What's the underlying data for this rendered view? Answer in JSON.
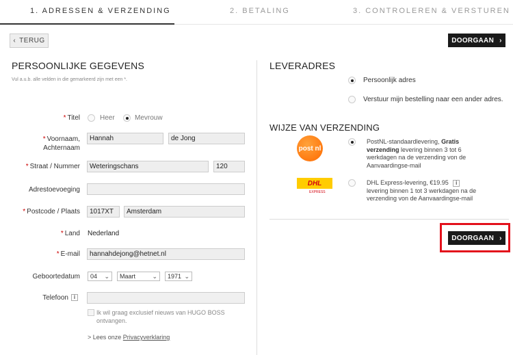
{
  "steps": [
    {
      "label": "1. ADRESSEN & VERZENDING"
    },
    {
      "label": "2. BETALING"
    },
    {
      "label": "3. CONTROLEREN & VERSTUREN"
    }
  ],
  "toolbar": {
    "back_label": "TERUG",
    "continue_label": "DOORGAAN"
  },
  "personal": {
    "heading": "PERSOONLIJKE GEGEVENS",
    "note": "Vul a.u.b. alle velden in die gemarkeerd zijn met een *.",
    "title_label": "Titel",
    "title_options": [
      "Heer",
      "Mevrouw"
    ],
    "name_label_1": "Voornaam,",
    "name_label_2": "Achternaam",
    "first_name": "Hannah",
    "last_name": "de Jong",
    "street_label": "Straat  /  Nummer",
    "street": "Weteringschans",
    "number": "120",
    "addition_label": "Adrestoevoeging",
    "addition": "",
    "postcode_label": "Postcode  /  Plaats",
    "postcode": "1017XT",
    "city": "Amsterdam",
    "country_label": "Land",
    "country": "Nederland",
    "email_label": "E-mail",
    "email": "hannahdejong@hetnet.nl",
    "birthdate_label": "Geboortedatum",
    "birth_day": "04",
    "birth_month": "Maart",
    "birth_year": "1971",
    "phone_label": "Telefoon",
    "phone": "",
    "newsletter_label": "Ik wil graag exclusief nieuws van HUGO BOSS ontvangen.",
    "privacy_prefix": "> Lees onze ",
    "privacy_link": "Privacyverklaring",
    "required_mark": "*",
    "info_icon": "i"
  },
  "delivery": {
    "heading": "LEVERADRES",
    "options": [
      "Persoonlijk adres",
      "Verstuur mijn bestelling naar een ander adres."
    ]
  },
  "shipping": {
    "heading": "WIJZE VAN VERZENDING",
    "postnl_logo": "post nl",
    "postnl_prefix": "PostNL-standaardlevering, ",
    "postnl_bold": "Gratis verzending",
    "postnl_rest": " levering binnen 3 tot 6 werkdagen na de verzending von de Aanvaardingse-mail",
    "dhl_logo": "DHL",
    "dhl_logo_sub": "EXPRESS",
    "dhl_title": "DHL Express-levering, €19.95",
    "dhl_rest": "levering binnen 1 tot 3 werkdagen na de verzending von de Aanvaardingse-mail"
  }
}
